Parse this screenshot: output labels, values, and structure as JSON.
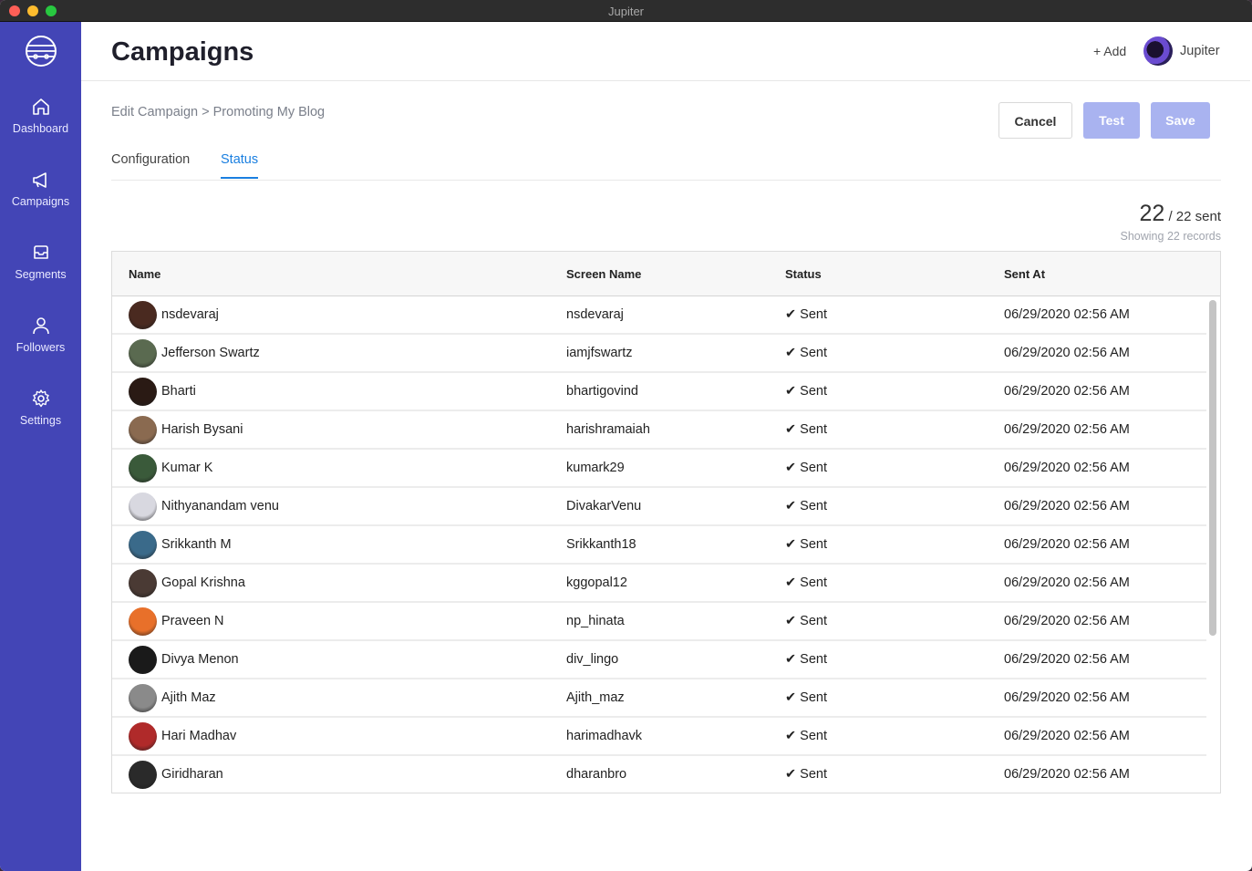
{
  "window": {
    "title": "Jupiter"
  },
  "sidebar": {
    "items": [
      {
        "label": "Dashboard",
        "icon": "home-icon"
      },
      {
        "label": "Campaigns",
        "icon": "megaphone-icon"
      },
      {
        "label": "Segments",
        "icon": "inbox-icon"
      },
      {
        "label": "Followers",
        "icon": "user-icon"
      },
      {
        "label": "Settings",
        "icon": "gear-icon"
      }
    ]
  },
  "header": {
    "title": "Campaigns",
    "add_label": "+ Add",
    "user_name": "Jupiter"
  },
  "breadcrumb": "Edit Campaign > Promoting My Blog",
  "actions": {
    "cancel": "Cancel",
    "test": "Test",
    "save": "Save"
  },
  "tabs": [
    {
      "label": "Configuration"
    },
    {
      "label": "Status",
      "active": true
    }
  ],
  "summary": {
    "sent": "22",
    "total_text": "/ 22 sent",
    "showing": "Showing 22 records"
  },
  "table": {
    "columns": [
      "Name",
      "Screen Name",
      "Status",
      "Sent At"
    ],
    "rows": [
      {
        "name": "nsdevaraj",
        "screen_name": "nsdevaraj",
        "status": "✔ Sent",
        "sent_at": "06/29/2020 02:56 AM",
        "avatar_color": "#4a2a20"
      },
      {
        "name": "Jefferson Swartz",
        "screen_name": "iamjfswartz",
        "status": "✔ Sent",
        "sent_at": "06/29/2020 02:56 AM",
        "avatar_color": "#5a6a50"
      },
      {
        "name": "Bharti",
        "screen_name": "bhartigovind",
        "status": "✔ Sent",
        "sent_at": "06/29/2020 02:56 AM",
        "avatar_color": "#2a1a14"
      },
      {
        "name": "Harish Bysani",
        "screen_name": "harishramaiah",
        "status": "✔ Sent",
        "sent_at": "06/29/2020 02:56 AM",
        "avatar_color": "#8a6a50"
      },
      {
        "name": "Kumar K",
        "screen_name": "kumark29",
        "status": "✔ Sent",
        "sent_at": "06/29/2020 02:56 AM",
        "avatar_color": "#3a5a3a"
      },
      {
        "name": "Nithyanandam venu",
        "screen_name": "DivakarVenu",
        "status": "✔ Sent",
        "sent_at": "06/29/2020 02:56 AM",
        "avatar_color": "#d8d8e0"
      },
      {
        "name": "Srikkanth M",
        "screen_name": "Srikkanth18",
        "status": "✔ Sent",
        "sent_at": "06/29/2020 02:56 AM",
        "avatar_color": "#3a6a8a"
      },
      {
        "name": "Gopal Krishna",
        "screen_name": "kggopal12",
        "status": "✔ Sent",
        "sent_at": "06/29/2020 02:56 AM",
        "avatar_color": "#4a3a34"
      },
      {
        "name": "Praveen N",
        "screen_name": "np_hinata",
        "status": "✔ Sent",
        "sent_at": "06/29/2020 02:56 AM",
        "avatar_color": "#e8702a"
      },
      {
        "name": "Divya Menon",
        "screen_name": "div_lingo",
        "status": "✔ Sent",
        "sent_at": "06/29/2020 02:56 AM",
        "avatar_color": "#1a1a1a"
      },
      {
        "name": "Ajith Maz",
        "screen_name": "Ajith_maz",
        "status": "✔ Sent",
        "sent_at": "06/29/2020 02:56 AM",
        "avatar_color": "#8a8a8a"
      },
      {
        "name": "Hari Madhav",
        "screen_name": "harimadhavk",
        "status": "✔ Sent",
        "sent_at": "06/29/2020 02:56 AM",
        "avatar_color": "#b02a2a"
      },
      {
        "name": "Giridharan",
        "screen_name": "dharanbro",
        "status": "✔ Sent",
        "sent_at": "06/29/2020 02:56 AM",
        "avatar_color": "#2a2a2a"
      }
    ]
  }
}
